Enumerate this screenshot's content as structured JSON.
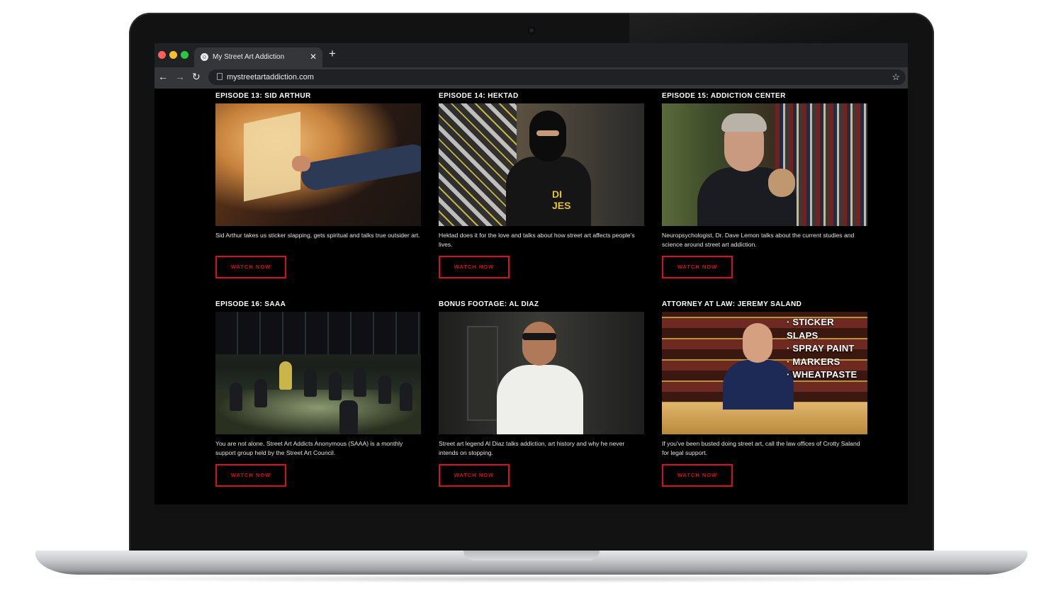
{
  "browser": {
    "tab_title": "My Street Art Addiction",
    "tab_close": "✕",
    "new_tab": "+",
    "url": "mystreetartaddiction.com",
    "back": "←",
    "forward": "→",
    "reload": "↻",
    "bookmark": "☆"
  },
  "videos": [
    {
      "title": "EPISODE 13: SID ARTHUR",
      "description": "Sid Arthur takes us sticker slapping, gets spiritual and talks true outsider art.",
      "button": "WATCH NOW"
    },
    {
      "title": "EPISODE 14: HEKTAD",
      "description": "Hektad does it for the love and talks about how street art affects people's lives.",
      "button": "WATCH NOW"
    },
    {
      "title": "EPISODE 15: ADDICTION CENTER",
      "description": "Neuropsychologist, Dr. Dave Lemon talks about the current studies and science around street art addiction.",
      "button": "WATCH NOW"
    },
    {
      "title": "EPISODE 16: SAAA",
      "description": "You are not alone. Street Art Addicts Anonymous (SAAA) is a monthly support group held by the Street Art Council.",
      "button": "WATCH NOW"
    },
    {
      "title": "BONUS FOOTAGE: AL DIAZ",
      "description": "Street art legend Al Diaz talks addiction, art history and why he never intends on stopping.",
      "button": "WATCH NOW"
    },
    {
      "title": "ATTORNEY AT LAW: JEREMY SALAND",
      "description": "If you've been busted doing street art, call the law offices of Crotty Saland for legal support.",
      "button": "WATCH NOW",
      "overlay": [
        "STICKER SLAPS",
        "SPRAY PAINT",
        "MARKERS",
        "WHEATPASTE"
      ]
    }
  ],
  "hektad_shirt": "DI\nJES",
  "colors": {
    "accent_red": "#d4111c",
    "page_bg": "#000000",
    "chrome_dark": "#202124",
    "chrome_mid": "#35363a"
  }
}
